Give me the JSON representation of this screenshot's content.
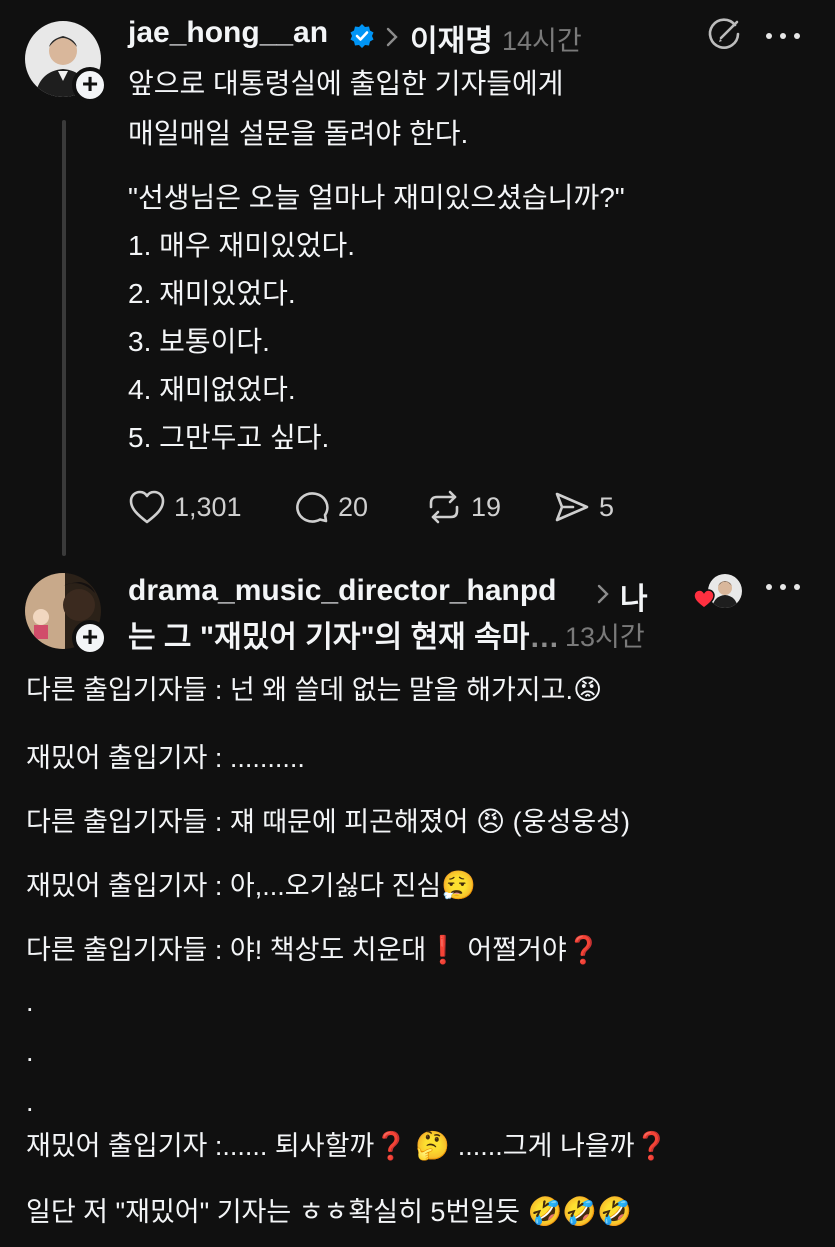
{
  "post1": {
    "username": "jae_hong__an",
    "topic": "이재명",
    "time": "14시간",
    "lines": [
      "앞으로 대통령실에 출입한 기자들에게",
      "매일매일 설문을 돌려야 한다.",
      "\"선생님은 오늘 얼마나 재미있으셨습니까?\"",
      "1. 매우 재미있었다.",
      "2. 재미있었다.",
      "3. 보통이다.",
      "4. 재미없었다.",
      "5. 그만두고 싶다."
    ],
    "likes": "1,301",
    "replies": "20",
    "reposts": "19",
    "shares": "5"
  },
  "post2": {
    "username": "drama_music_director_hanpd",
    "topic_part1": "나",
    "topic_part2": "는 그 \"재밌어 기자\"의 현재 속마",
    "topic_ellipsis": "…",
    "time": "13시간",
    "lines": [
      {
        "text": "다른 출입기자들 : 넌 왜 쓸데 없는 말을 해가지고.",
        "emoji": "😡"
      },
      {
        "text": "재밌어 출입기자 : .........."
      },
      {
        "text": "다른 출입기자들 : 쟤 때문에 피곤해졌어 ",
        "emoji": "😠",
        "suffix": " (웅성웅성)"
      },
      {
        "text": "재밌어 출입기자 : 아,...오기싫다 진심",
        "emoji": "😮‍💨"
      },
      {
        "text": "다른 출입기자들 : 야! 책상도 치운대",
        "mark1": "❗",
        "middle": "  어쩔거야",
        "mark2": "❓"
      },
      {
        "text": "."
      },
      {
        "text": "."
      },
      {
        "text": "."
      },
      {
        "text": "재밌어 출입기자 :...... 퇴사할까",
        "mark1": "❓",
        "emoji": "🤔",
        "middle": " ......그게 나을까",
        "mark2": "❓"
      },
      {
        "text": "일단 저 \"재밌어\" 기자는 ㅎㅎ확실히 5번일듯 ",
        "emoji": "🤣🤣🤣"
      }
    ]
  },
  "colors": {
    "background": "#101010",
    "text": "#f3f5f7",
    "secondary": "#8c8c8c",
    "verified": "#0095f6",
    "heart": "#ff3040"
  },
  "icons": [
    "verified-badge-icon",
    "chevron-right-icon",
    "edit-circle-icon",
    "more-icon",
    "heart-icon",
    "comment-icon",
    "repost-icon",
    "share-icon",
    "plus-icon"
  ]
}
